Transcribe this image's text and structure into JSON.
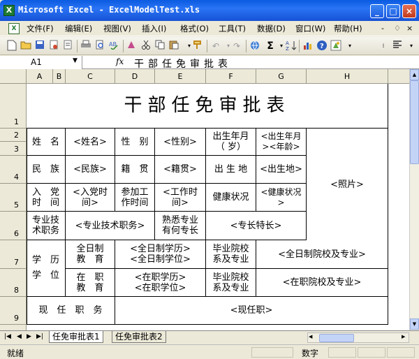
{
  "window": {
    "title": "Microsoft Excel - ExcelModelTest.xls",
    "minimize": "_",
    "maximize": "□",
    "close": "×"
  },
  "menu": {
    "items": [
      "文件(F)",
      "编辑(E)",
      "视图(V)",
      "插入(I)",
      "格式(O)",
      "工具(T)",
      "数据(D)",
      "窗口(W)",
      "帮助(H)"
    ],
    "doc_controls": [
      "-",
      "♢",
      "×"
    ]
  },
  "toolbar": {
    "icons": [
      "new-icon",
      "open-icon",
      "save-icon",
      "permission-icon",
      "email-icon",
      "print-icon",
      "print-preview-icon",
      "spelling-icon",
      "cut-icon",
      "copy-icon",
      "paste-icon",
      "format-painter-icon",
      "undo-icon",
      "hyperlink-icon",
      "autosum-icon",
      "sort-ascending-icon",
      "chart-wizard-icon",
      "help-icon",
      "research-icon",
      "align-left-icon"
    ],
    "autosum": "Σ"
  },
  "formula_bar": {
    "name_box": "A1",
    "fx": "fx",
    "content": "干部任免审批表"
  },
  "columns": [
    "A",
    "B",
    "C",
    "D",
    "E",
    "F",
    "G",
    "H"
  ],
  "rows": [
    "1",
    "2",
    "3",
    "4",
    "5",
    "6",
    "7",
    "8",
    "9"
  ],
  "cells": {
    "title": "干部任免审批表",
    "name_label": "姓　名",
    "name_val": "<姓名>",
    "gender_label": "性　别",
    "gender_val": "<性别>",
    "birth_label": "出生年月\n（ 岁）",
    "birth_val": "<出生年月\n><年龄>",
    "photo": "<照片>",
    "ethnic_label": "民　族",
    "ethnic_val": "<民族>",
    "native_label": "籍　贯",
    "native_val": "<籍贯>",
    "birthplace_label": "出 生 地",
    "birthplace_val": "<出生地>",
    "party_label": "入　党\n时　间",
    "party_val": "<入党时\n间>",
    "work_label": "参加工\n作时间",
    "work_val": "<工作时\n间>",
    "health_label": "健康状况",
    "health_val": "<健康状况\n>",
    "title_label": "专业技\n术职务",
    "title_val": "<专业技术职务>",
    "expertise_label": "熟悉专业\n有何专长",
    "expertise_val": "<专长特长>",
    "edu_label": "学　历\n学　位",
    "fulltime_label": "全日制\n教　育",
    "fulltime_val": "<全日制学历>\n<全日制学位>",
    "grad_label1": "毕业院校\n系及专业",
    "fulltime_school": "<全日制院校及专业>",
    "inservice_label": "在　职\n教　育",
    "inservice_val": "<在职学历>\n<在职学位>",
    "grad_label2": "毕业院校\n系及专业",
    "inservice_school": "<在职院校及专业>",
    "position_label": "现　任　职　务",
    "position_val": "<现任职>"
  },
  "sheet_tabs": [
    "任免审批表1",
    "任免审批表2"
  ],
  "tab_nav": [
    "|◀",
    "◀",
    "▶",
    "▶|"
  ],
  "status": {
    "ready": "就绪",
    "numlock": "数字"
  }
}
